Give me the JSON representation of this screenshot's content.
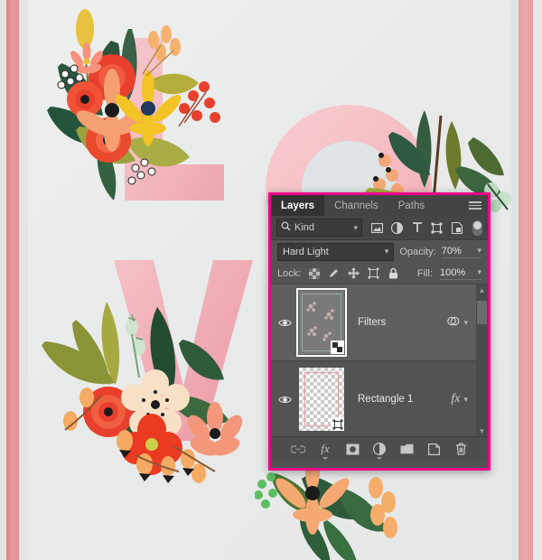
{
  "artwork": {
    "description": "Floral paper-cut alphabet letters on light grey paper background",
    "letters": [
      {
        "glyph": "L",
        "color": "#f0b3b8"
      },
      {
        "glyph": "O",
        "color": "#f5c3c6"
      },
      {
        "glyph": "V",
        "color": "#f0a9b0"
      }
    ],
    "stripe_color_left": "#e28e93",
    "stripe_color_right": "#e69a9e",
    "paper_color": "#e9ebeb"
  },
  "panel": {
    "highlight_color": "#ec008c",
    "background_color": "#535353",
    "tabs": [
      {
        "label": "Layers",
        "active": true
      },
      {
        "label": "Channels",
        "active": false
      },
      {
        "label": "Paths",
        "active": false
      }
    ],
    "menu_icon": "hamburger-menu-icon",
    "filter_row": {
      "kind_label": "Kind",
      "kind_icon": "search-icon",
      "icons": [
        "pixel-layer-filter-icon",
        "adjustment-layer-filter-icon",
        "type-layer-filter-icon",
        "shape-layer-filter-icon",
        "smart-object-filter-icon"
      ],
      "toggle": "filter-toggle-switch"
    },
    "blend_row": {
      "blend_mode": "Hard Light",
      "opacity_label": "Opacity:",
      "opacity_value": "70%"
    },
    "lock_row": {
      "lock_label": "Lock:",
      "icons": [
        "lock-transparent-pixels-icon",
        "lock-image-pixels-icon",
        "lock-position-icon",
        "lock-artboard-nesting-icon",
        "lock-all-icon"
      ],
      "fill_label": "Fill:",
      "fill_value": "100%"
    },
    "layers": [
      {
        "name": "Filters",
        "visible": true,
        "selected": true,
        "thumb_type": "smart-object",
        "badge": "smart-object-badge-icon",
        "right_icons": [
          "smart-filter-icon",
          "chevron-down-icon"
        ]
      },
      {
        "name": "Rectangle 1",
        "visible": true,
        "selected": false,
        "thumb_type": "vector-shape",
        "badge": "vector-mask-badge-icon",
        "right_icons": [
          "fx-icon",
          "chevron-down-icon"
        ]
      }
    ],
    "scrollbar": {
      "up_arrow": "scroll-up-arrow-icon",
      "down_arrow": "scroll-down-arrow-icon"
    },
    "bottom_bar": [
      "link-layers-icon",
      "add-layer-style-fx-icon",
      "add-layer-mask-icon",
      "new-adjustment-layer-icon",
      "new-group-icon",
      "new-layer-icon",
      "delete-layer-icon"
    ]
  }
}
